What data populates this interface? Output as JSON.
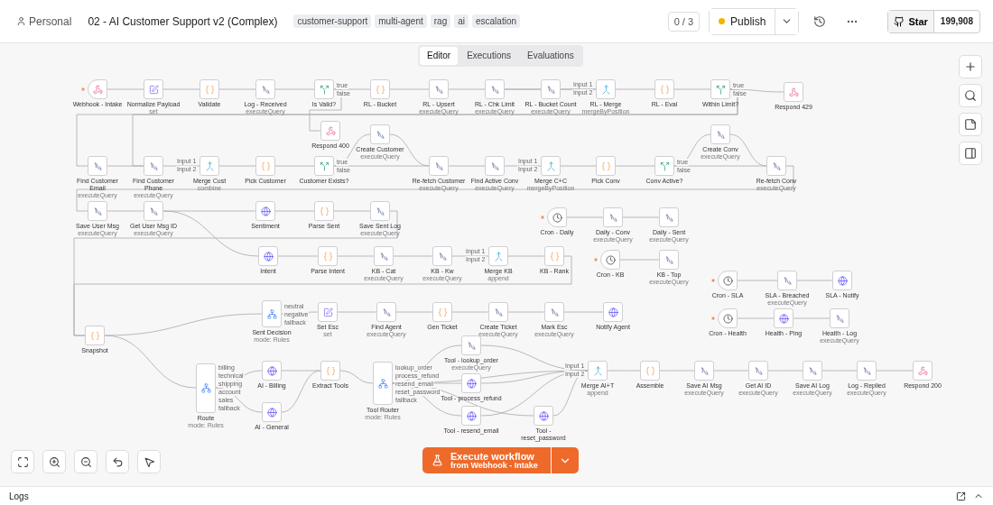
{
  "breadcrumb": {
    "owner": "Personal",
    "title": "02 - AI Customer Support v2 (Complex)"
  },
  "tags": [
    "customer-support",
    "multi-agent",
    "rag",
    "ai",
    "escalation"
  ],
  "header": {
    "counter": "0 / 3",
    "publish": "Publish",
    "star": "Star",
    "stars_count": "199,908"
  },
  "tabs": [
    {
      "label": "Editor",
      "selected": true
    },
    {
      "label": "Executions",
      "selected": false
    },
    {
      "label": "Evaluations",
      "selected": false
    }
  ],
  "nodes": [
    {
      "label": "Webhook - Intake",
      "kind": "webhook",
      "trigger": true
    },
    {
      "label": "Normalize Payload",
      "kind": "set",
      "subtitle": "set"
    },
    {
      "label": "Validate",
      "kind": "code"
    },
    {
      "label": "Log - Received",
      "kind": "query",
      "subtitle": "executeQuery"
    },
    {
      "label": "Is Valid?",
      "kind": "if",
      "outputs": [
        "true",
        "false"
      ]
    },
    {
      "label": "RL - Bucket",
      "kind": "code"
    },
    {
      "label": "RL - Upsert",
      "kind": "query",
      "subtitle": "executeQuery"
    },
    {
      "label": "RL - Chk Limit",
      "kind": "query",
      "subtitle": "executeQuery"
    },
    {
      "label": "RL - Bucket Count",
      "kind": "query",
      "subtitle": "executeQuery"
    },
    {
      "label": "RL - Merge",
      "kind": "merge",
      "subtitle": "mergeByPosition",
      "inputs": [
        "Input 1",
        "Input 2"
      ]
    },
    {
      "label": "RL - Eval",
      "kind": "code"
    },
    {
      "label": "Within Limit?",
      "kind": "if",
      "outputs": [
        "true",
        "false"
      ]
    },
    {
      "label": "Respond 429",
      "kind": "webhook"
    },
    {
      "label": "Respond 400",
      "kind": "webhook"
    },
    {
      "label": "Create Customer",
      "kind": "query",
      "subtitle": "executeQuery"
    },
    {
      "label": "Create Conv",
      "kind": "query",
      "subtitle": "executeQuery"
    },
    {
      "label": "Find Customer Email",
      "kind": "query",
      "subtitle": "executeQuery"
    },
    {
      "label": "Find Customer Phone",
      "kind": "query",
      "subtitle": "executeQuery"
    },
    {
      "label": "Merge Cust",
      "kind": "merge",
      "subtitle": "combine",
      "inputs": [
        "Input 1",
        "Input 2"
      ]
    },
    {
      "label": "Pick Customer",
      "kind": "code"
    },
    {
      "label": "Customer Exists?",
      "kind": "if",
      "outputs": [
        "true",
        "false"
      ]
    },
    {
      "label": "Re-fetch Customer",
      "kind": "query",
      "subtitle": "executeQuery"
    },
    {
      "label": "Find Active Conv",
      "kind": "query",
      "subtitle": "executeQuery"
    },
    {
      "label": "Merge C+C",
      "kind": "merge",
      "subtitle": "mergeByPosition",
      "inputs": [
        "Input 1",
        "Input 2"
      ]
    },
    {
      "label": "Pick Conv",
      "kind": "code"
    },
    {
      "label": "Conv Active?",
      "kind": "if",
      "outputs": [
        "true",
        "false"
      ]
    },
    {
      "label": "Re-fetch Conv",
      "kind": "query",
      "subtitle": "executeQuery"
    },
    {
      "label": "Save User Msg",
      "kind": "query",
      "subtitle": "executeQuery"
    },
    {
      "label": "Get User Msg ID",
      "kind": "query",
      "subtitle": "executeQuery"
    },
    {
      "label": "Sentiment",
      "kind": "http"
    },
    {
      "label": "Parse Sent",
      "kind": "code"
    },
    {
      "label": "Save Sent Log",
      "kind": "query",
      "subtitle": "executeQuery"
    },
    {
      "label": "Cron - Daily",
      "kind": "cron",
      "trigger": true
    },
    {
      "label": "Daily - Conv",
      "kind": "query",
      "subtitle": "executeQuery"
    },
    {
      "label": "Daily - Sent",
      "kind": "query",
      "subtitle": "executeQuery"
    },
    {
      "label": "Intent",
      "kind": "http"
    },
    {
      "label": "Parse Intent",
      "kind": "code"
    },
    {
      "label": "KB - Cat",
      "kind": "query",
      "subtitle": "executeQuery"
    },
    {
      "label": "KB - Kw",
      "kind": "query",
      "subtitle": "executeQuery"
    },
    {
      "label": "Merge KB",
      "kind": "merge",
      "subtitle": "append",
      "inputs": [
        "Input 1",
        "Input 2"
      ]
    },
    {
      "label": "KB - Rank",
      "kind": "code"
    },
    {
      "label": "Cron - KB",
      "kind": "cron",
      "trigger": true
    },
    {
      "label": "KB - Top",
      "kind": "query",
      "subtitle": "executeQuery"
    },
    {
      "label": "Cron - SLA",
      "kind": "cron",
      "trigger": true
    },
    {
      "label": "SLA - Breached",
      "kind": "query",
      "subtitle": "executeQuery"
    },
    {
      "label": "SLA - Notify",
      "kind": "http"
    },
    {
      "label": "Sent Decision",
      "kind": "switch",
      "subtitle": "mode: Rules",
      "outputs": [
        "neutral",
        "negative",
        "fallback"
      ]
    },
    {
      "label": "Set Esc",
      "kind": "set",
      "subtitle": "set"
    },
    {
      "label": "Find Agent",
      "kind": "query",
      "subtitle": "executeQuery"
    },
    {
      "label": "Gen Ticket",
      "kind": "code"
    },
    {
      "label": "Create Ticket",
      "kind": "query",
      "subtitle": "executeQuery"
    },
    {
      "label": "Mark Esc",
      "kind": "query",
      "subtitle": "executeQuery"
    },
    {
      "label": "Notify Agent",
      "kind": "http"
    },
    {
      "label": "Cron - Health",
      "kind": "cron",
      "trigger": true
    },
    {
      "label": "Health - Ping",
      "kind": "http"
    },
    {
      "label": "Health - Log",
      "kind": "query",
      "subtitle": "executeQuery"
    },
    {
      "label": "Snapshot",
      "kind": "code"
    },
    {
      "label": "Route",
      "kind": "switch",
      "subtitle": "mode: Rules",
      "outputs": [
        "billing",
        "technical",
        "shipping",
        "account",
        "sales",
        "fallback"
      ]
    },
    {
      "label": "AI - Billing",
      "kind": "http"
    },
    {
      "label": "AI - General",
      "kind": "http"
    },
    {
      "label": "Extract Tools",
      "kind": "code"
    },
    {
      "label": "Tool Router",
      "kind": "switch",
      "subtitle": "mode: Rules",
      "outputs": [
        "lookup_order",
        "process_refund",
        "resend_email",
        "reset_password",
        "fallback"
      ]
    },
    {
      "label": "Tool - lookup_order",
      "kind": "query",
      "subtitle": "executeQuery"
    },
    {
      "label": "Tool - process_refund",
      "kind": "http"
    },
    {
      "label": "Tool - resend_email",
      "kind": "http"
    },
    {
      "label": "Tool - reset_password",
      "kind": "http"
    },
    {
      "label": "Merge AI+T",
      "kind": "merge",
      "subtitle": "append",
      "inputs": [
        "Input 1",
        "Input 2"
      ]
    },
    {
      "label": "Assemble",
      "kind": "code"
    },
    {
      "label": "Save AI Msg",
      "kind": "query",
      "subtitle": "executeQuery"
    },
    {
      "label": "Get AI ID",
      "kind": "query",
      "subtitle": "executeQuery"
    },
    {
      "label": "Save AI Log",
      "kind": "query",
      "subtitle": "executeQuery"
    },
    {
      "label": "Log - Replied",
      "kind": "query",
      "subtitle": "executeQuery"
    },
    {
      "label": "Respond 200",
      "kind": "webhook"
    }
  ],
  "execute": {
    "label": "Execute workflow",
    "sublabel": "from Webhook - Intake"
  },
  "logs": {
    "label": "Logs"
  }
}
